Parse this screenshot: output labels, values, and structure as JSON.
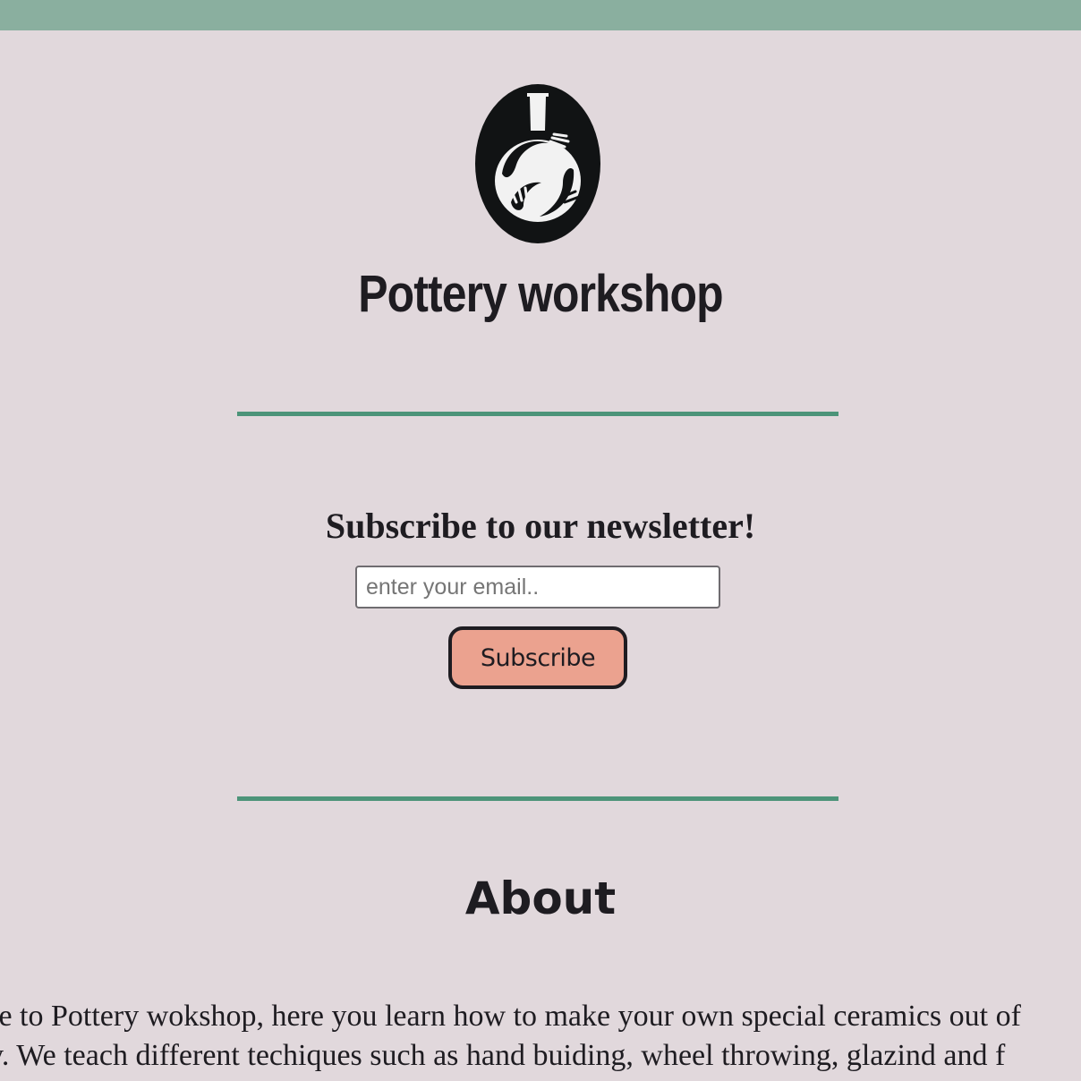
{
  "header": {
    "logo_icon": "pottery-vase-hands-icon",
    "title": "Pottery workshop"
  },
  "newsletter": {
    "heading": "Subscribe to our newsletter!",
    "email_placeholder": "enter your email..",
    "email_value": "",
    "subscribe_label": "Subscribe"
  },
  "about": {
    "heading": "About",
    "lines": [
      "me to Pottery wokshop, here you learn how to make your own special ceramics out of",
      "ay. We teach different techiques such as hand buiding, wheel throwing, glazind and f"
    ]
  },
  "colors": {
    "top_bar": "#8aaf9f",
    "background": "#e1d8dc",
    "divider": "#4c9479",
    "button": "#eba28f",
    "text": "#1e1c21"
  }
}
